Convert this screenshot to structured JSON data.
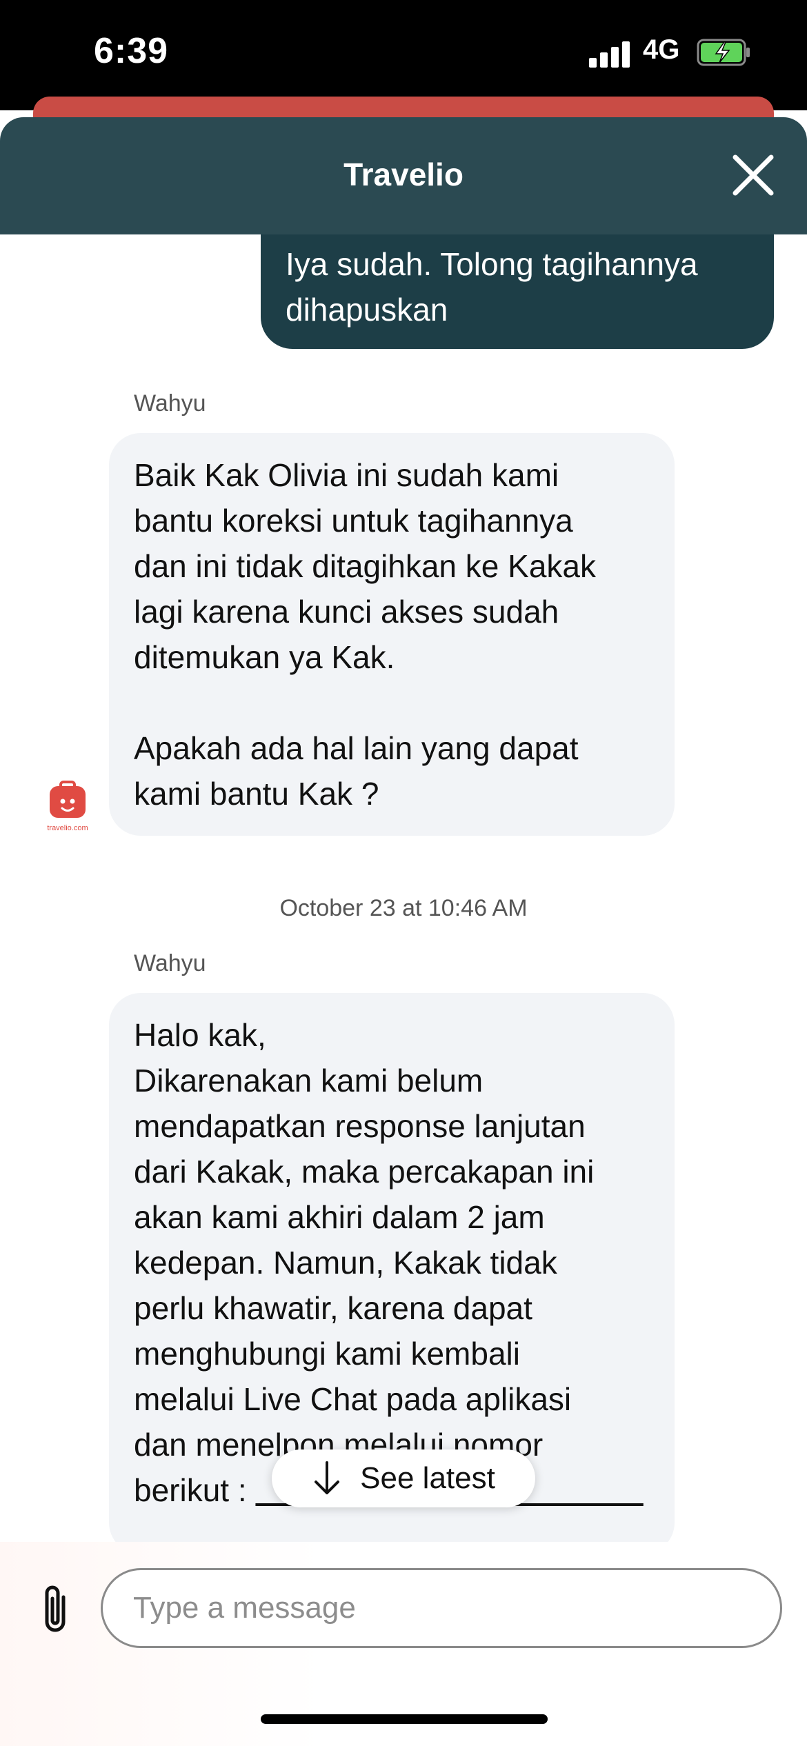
{
  "status_bar": {
    "time": "6:39",
    "network": "4G",
    "icons": [
      "signal-icon",
      "battery-charging-icon"
    ]
  },
  "header": {
    "title": "Travelio",
    "close_icon": "close-icon"
  },
  "messages": {
    "outgoing_1": {
      "lines": [
        "Iya sudah. Tolong tagihannya",
        "dihapuskan"
      ]
    },
    "incoming_1": {
      "sender": "Wahyu",
      "lines": [
        "Baik Kak Olivia ini sudah kami",
        "bantu koreksi untuk tagihannya",
        "dan ini tidak ditagihkan ke Kakak",
        "lagi karena kunci akses sudah",
        "ditemukan ya Kak.",
        "",
        "Apakah ada hal lain yang dapat",
        "kami bantu Kak ?"
      ],
      "avatar_text": "travelio.com"
    },
    "timestamp": "October 23 at 10:46 AM",
    "incoming_2": {
      "sender": "Wahyu",
      "lines": [
        "Halo kak,",
        "Dikarenakan kami belum",
        "mendapatkan response lanjutan",
        "dari Kakak, maka percakapan ini",
        "akan kami akhiri dalam 2 jam",
        "kedepan. Namun, Kakak tidak",
        "perlu khawatir, karena dapat",
        "menghubungi kami kembali",
        "melalui Live Chat pada aplikasi",
        "dan menelpon melalui nomor",
        "berikut :"
      ]
    }
  },
  "see_latest": {
    "label": "See latest",
    "icon": "arrow-down-icon"
  },
  "composer": {
    "placeholder": "Type a message",
    "value": "",
    "attach_icon": "paperclip-icon"
  },
  "colors": {
    "header_bg": "#2b4a52",
    "outgoing_bubble": "#1d3e47",
    "incoming_bubble": "#f2f4f7",
    "red_strip": "#c94c45",
    "brand_red": "#e04b43"
  }
}
